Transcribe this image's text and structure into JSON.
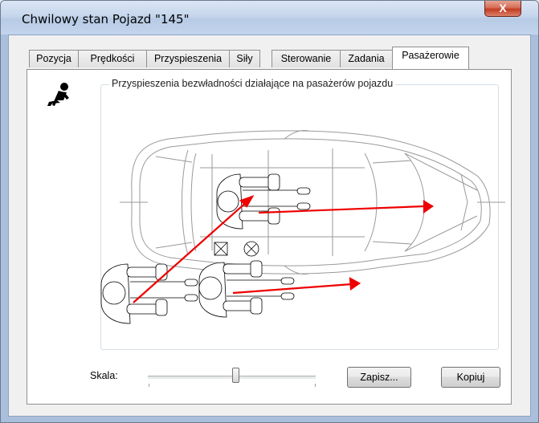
{
  "window": {
    "title": "Chwilowy stan Pojazd \"145\"",
    "close_label": "X"
  },
  "tabs": [
    {
      "label": "Pozycja",
      "active": false
    },
    {
      "label": "Prędkości",
      "active": false
    },
    {
      "label": "Przyspieszenia",
      "active": false
    },
    {
      "label": "Siły",
      "active": false
    },
    {
      "label": "Sterowanie",
      "active": false
    },
    {
      "label": "Zadania",
      "active": false
    },
    {
      "label": "Pasażerowie",
      "active": true
    }
  ],
  "panel": {
    "group_title": "Przyspieszenia bezwładności działające na pasażerów pojazdu",
    "icon": "seated-passenger-icon",
    "scale_label": "Skala:",
    "scale_value": 0.52,
    "save_button": "Zapisz...",
    "copy_button": "Kopiuj"
  },
  "colors": {
    "vector": "#ee0000",
    "car_outline": "#8c8c8c",
    "seat_outline": "#000000"
  }
}
